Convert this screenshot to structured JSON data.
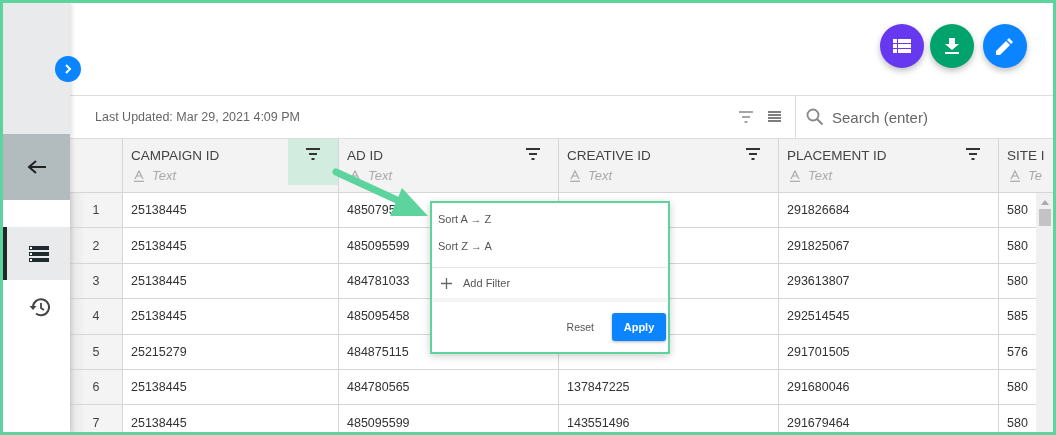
{
  "sidebar": {
    "items": [
      {
        "kind": "back",
        "selected": false
      },
      {
        "kind": "list",
        "selected": true
      },
      {
        "kind": "history",
        "selected": false
      }
    ]
  },
  "toolbar": {
    "last_updated": "Last Updated: Mar 29, 2021 4:09 PM",
    "search": {
      "placeholder": "Search (enter)"
    }
  },
  "table": {
    "columns": [
      {
        "title": "CAMPAIGN ID",
        "type": "Text",
        "filter_active": true
      },
      {
        "title": "AD ID",
        "type": "Text",
        "filter_active": false
      },
      {
        "title": "CREATIVE ID",
        "type": "Text",
        "filter_active": false
      },
      {
        "title": "PLACEMENT ID",
        "type": "Text",
        "filter_active": false
      },
      {
        "title": "SITE I",
        "type": "Te"
      }
    ],
    "rows": [
      {
        "index": "1",
        "cells": [
          "25138445",
          "4850795",
          null,
          "291826684",
          "580"
        ]
      },
      {
        "index": "2",
        "cells": [
          "25138445",
          "485095599",
          null,
          "291825067",
          "580"
        ]
      },
      {
        "index": "3",
        "cells": [
          "25138445",
          "484781033",
          null,
          "293613807",
          "580"
        ]
      },
      {
        "index": "4",
        "cells": [
          "25138445",
          "485095458",
          null,
          "292514545",
          "585"
        ]
      },
      {
        "index": "5",
        "cells": [
          "25215279",
          "484875115",
          null,
          "291701505",
          "576"
        ]
      },
      {
        "index": "6",
        "cells": [
          "25138445",
          "484780565",
          "137847225",
          "291680046",
          "580"
        ]
      },
      {
        "index": "7",
        "cells": [
          "25138445",
          "485095599",
          "143551496",
          "291679464",
          "580"
        ]
      }
    ]
  },
  "filter_menu": {
    "sort_options": [
      "Sort A → Z",
      "Sort Z → A"
    ],
    "add_filter": "Add Filter",
    "reset": "Reset",
    "apply": "Apply"
  }
}
